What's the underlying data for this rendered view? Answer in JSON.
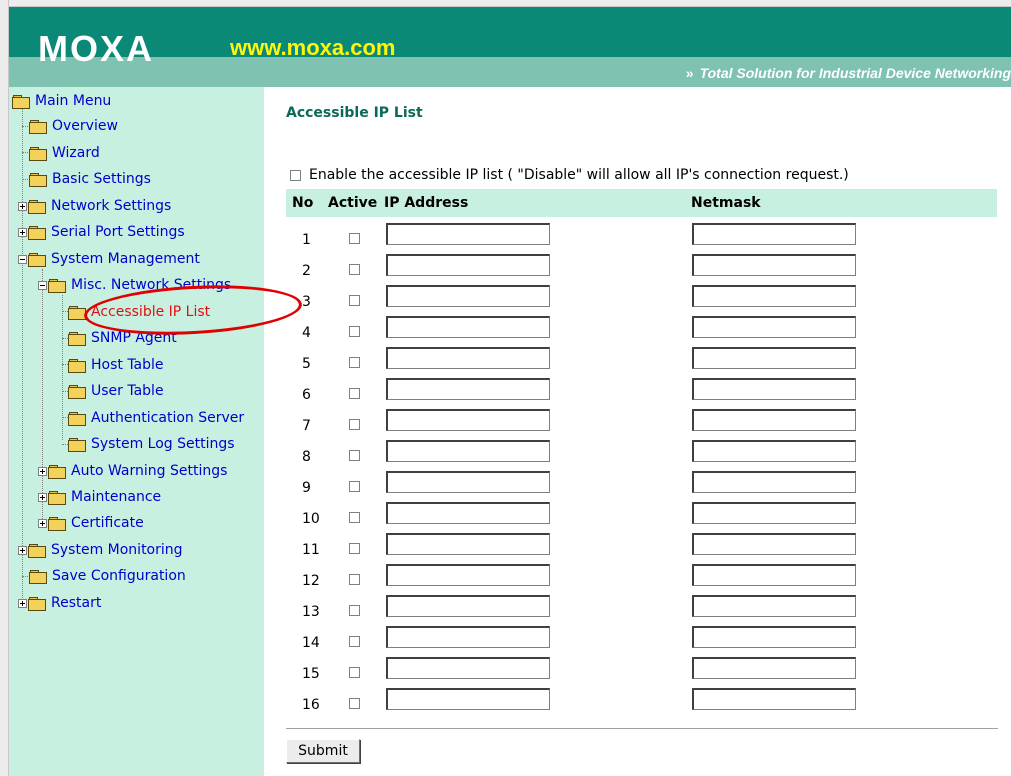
{
  "header": {
    "logo": "MOXA",
    "url": "www.moxa.com",
    "tagline_arrow": "»",
    "tagline": "Total Solution for Industrial Device Networking"
  },
  "sidebar": {
    "items": [
      {
        "label": "Main Menu"
      },
      {
        "label": "Overview"
      },
      {
        "label": "Wizard"
      },
      {
        "label": "Basic Settings"
      },
      {
        "label": "Network Settings"
      },
      {
        "label": "Serial Port Settings"
      },
      {
        "label": "System Management"
      },
      {
        "label": "Misc. Network Settings"
      },
      {
        "label": "Accessible IP List"
      },
      {
        "label": "SNMP Agent"
      },
      {
        "label": "Host Table"
      },
      {
        "label": "User Table"
      },
      {
        "label": "Authentication Server"
      },
      {
        "label": "System Log Settings"
      },
      {
        "label": "Auto Warning Settings"
      },
      {
        "label": "Maintenance"
      },
      {
        "label": "Certificate"
      },
      {
        "label": "System Monitoring"
      },
      {
        "label": "Save Configuration"
      },
      {
        "label": "Restart"
      }
    ]
  },
  "main": {
    "title": "Accessible IP List",
    "enable_label": "Enable the accessible IP list ( \"Disable\" will allow all IP's connection request.)",
    "columns": {
      "no": "No",
      "active": "Active",
      "ip": "IP Address",
      "mask": "Netmask"
    },
    "rows": [
      {
        "no": "1"
      },
      {
        "no": "2"
      },
      {
        "no": "3"
      },
      {
        "no": "4"
      },
      {
        "no": "5"
      },
      {
        "no": "6"
      },
      {
        "no": "7"
      },
      {
        "no": "8"
      },
      {
        "no": "9"
      },
      {
        "no": "10"
      },
      {
        "no": "11"
      },
      {
        "no": "12"
      },
      {
        "no": "13"
      },
      {
        "no": "14"
      },
      {
        "no": "15"
      },
      {
        "no": "16"
      }
    ],
    "submit_label": "Submit"
  },
  "colors": {
    "header_dark": "#0a8a76",
    "header_light": "#7fc2b1",
    "url_yellow": "#fff60a",
    "sidebar_bg": "#c8f0e1",
    "link_blue": "#0000c8",
    "active_red": "#e01010",
    "highlight_circle": "#e00000"
  }
}
